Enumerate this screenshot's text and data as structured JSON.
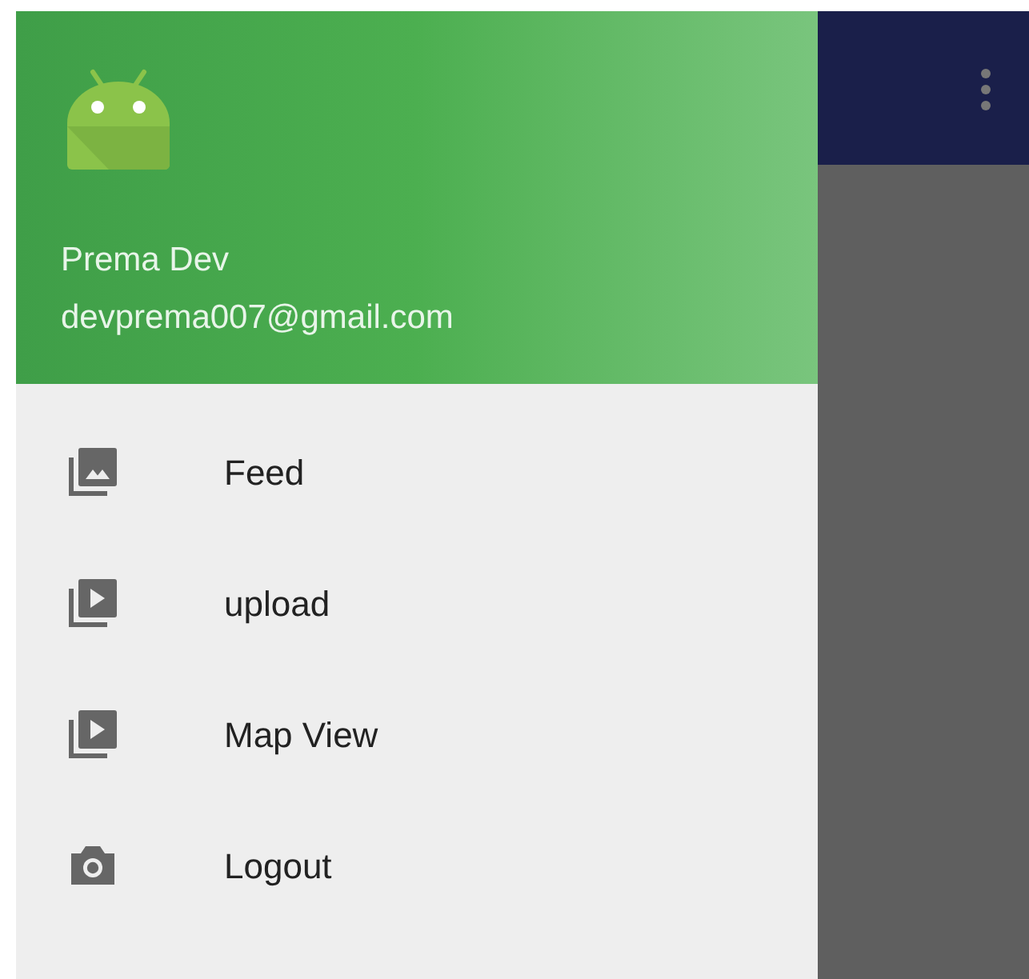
{
  "drawer": {
    "header": {
      "name": "Prema Dev",
      "email": "devprema007@gmail.com"
    },
    "items": [
      {
        "label": "Feed",
        "kind": "gallery"
      },
      {
        "label": "upload",
        "kind": "video"
      },
      {
        "label": "Map View",
        "kind": "video"
      },
      {
        "label": "Logout",
        "kind": "camera"
      }
    ]
  }
}
